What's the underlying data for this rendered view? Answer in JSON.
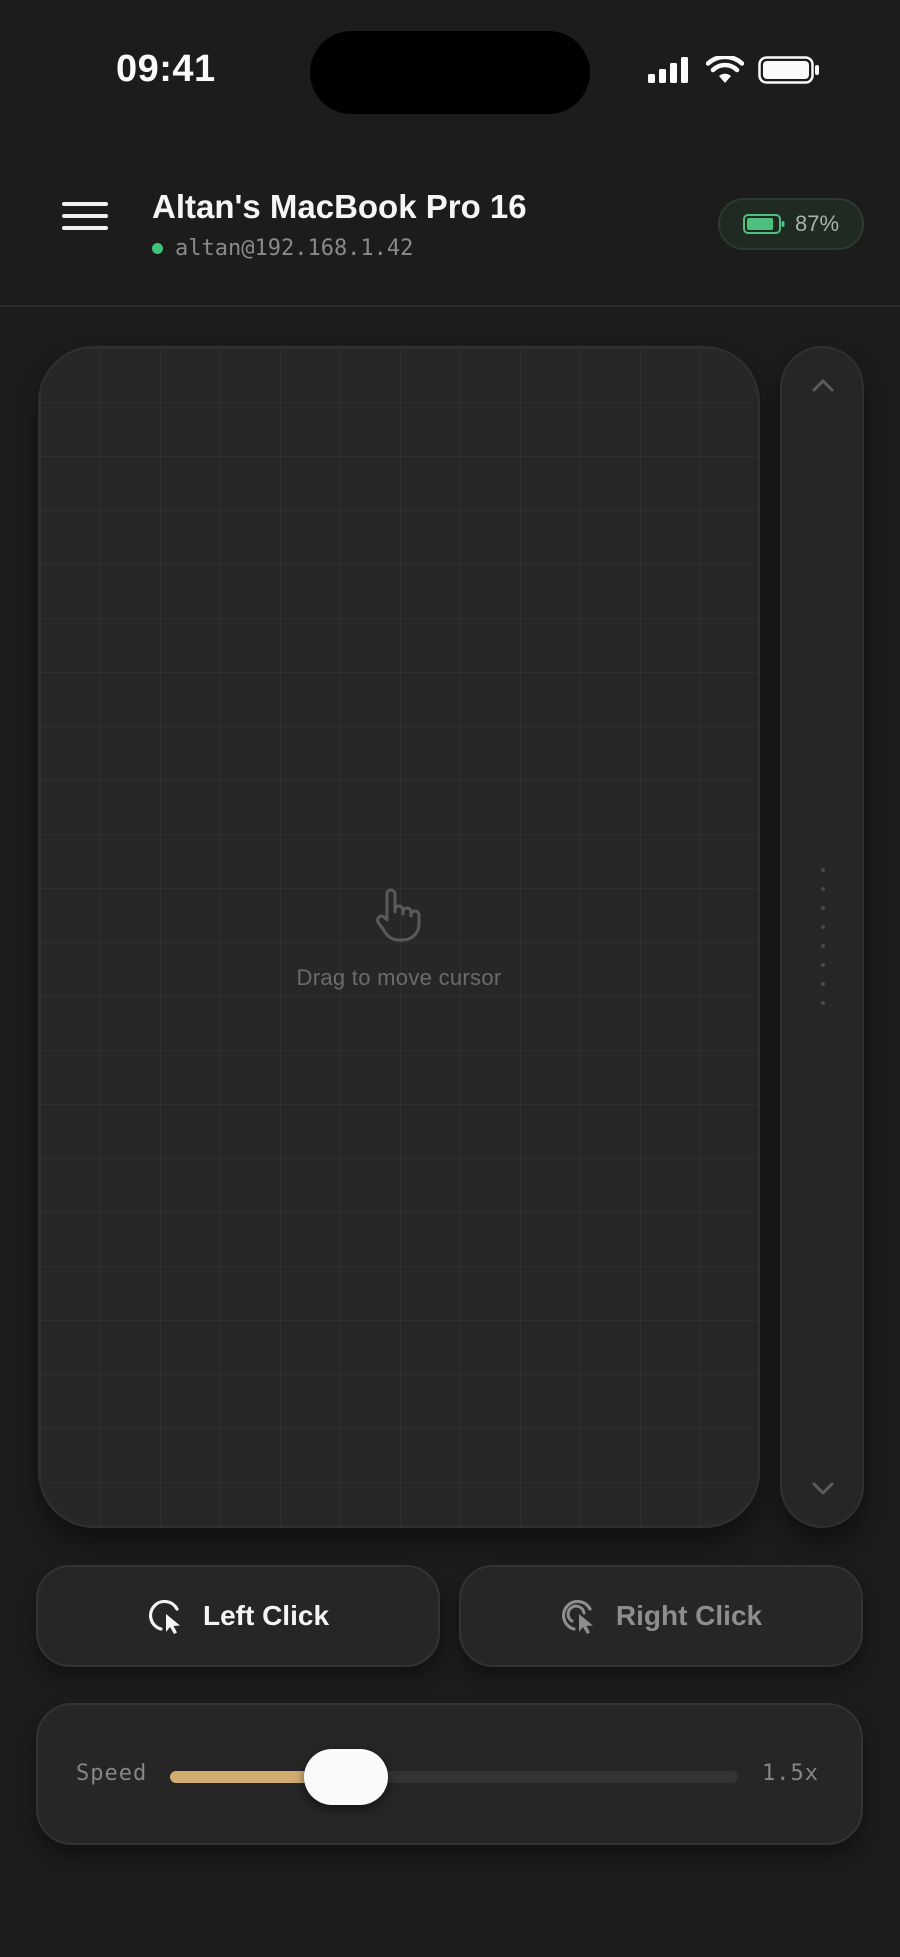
{
  "status_bar": {
    "time": "09:41"
  },
  "header": {
    "device_name": "Altan's MacBook Pro 16",
    "device_host": "altan@192.168.1.42",
    "connection_status_color": "#3fc47a",
    "battery_percent": "87%",
    "battery_level": 0.87
  },
  "trackpad": {
    "hint": "Drag to move cursor",
    "icon": "hand-pointer-icon"
  },
  "scroll": {
    "up_icon": "chevron-up-icon",
    "down_icon": "chevron-down-icon"
  },
  "buttons": {
    "left_click": "Left Click",
    "right_click": "Right Click"
  },
  "speed": {
    "label": "Speed",
    "value_text": "1.5x",
    "level": 0.31,
    "accent": "#d2ad6f"
  }
}
